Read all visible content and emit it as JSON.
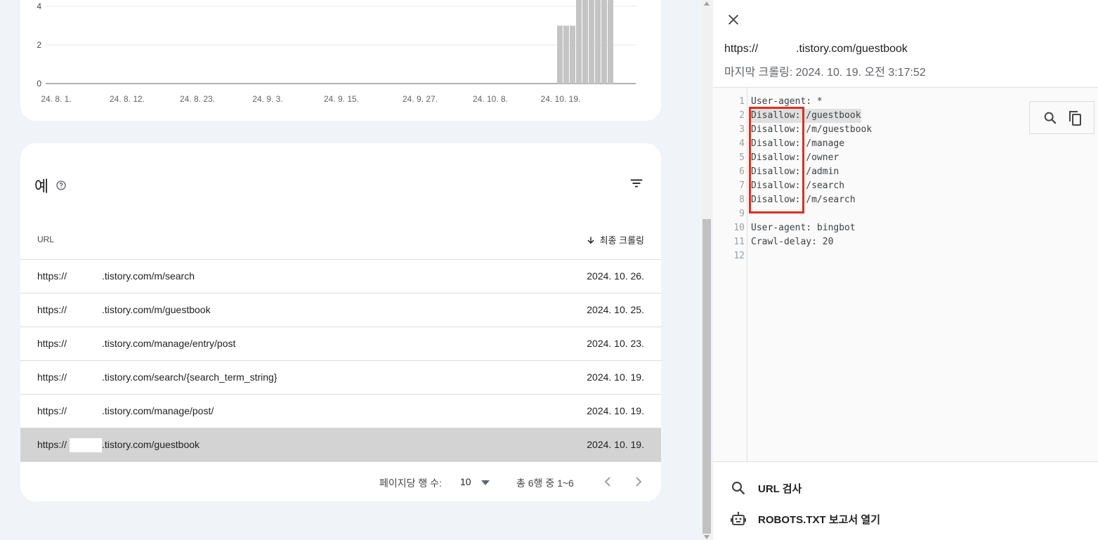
{
  "chart": {
    "chart_data": {
      "type": "bar",
      "y_ticks": [
        "0",
        "2",
        "4"
      ],
      "x_ticks": [
        "24. 8. 1.",
        "24. 8. 12.",
        "24. 8. 23.",
        "24. 9. 3.",
        "24. 9. 15.",
        "24. 9. 27.",
        "24. 10. 8.",
        "24. 10. 19."
      ],
      "ylim": [
        0,
        4
      ],
      "values_note": "",
      "bars": [
        {
          "value": 3
        },
        {
          "value": 3
        },
        {
          "value": 3
        },
        {
          "value": 6
        },
        {
          "value": 6
        },
        {
          "value": 6
        },
        {
          "value": 6
        },
        {
          "value": 6
        },
        {
          "value": 6
        }
      ],
      "bar_color": "#c4c4c4",
      "grid": true
    }
  },
  "table": {
    "title": "예",
    "help_icon": "help-icon",
    "filter_icon": "filter-icon",
    "col_url": "URL",
    "col_date": "최종 크롤링",
    "rows": [
      {
        "scheme": "https://",
        "path": ".tistory.com/m/search",
        "date": "2024. 10. 26."
      },
      {
        "scheme": "https://",
        "path": ".tistory.com/m/guestbook",
        "date": "2024. 10. 25."
      },
      {
        "scheme": "https://",
        "path": ".tistory.com/manage/entry/post",
        "date": "2024. 10. 23."
      },
      {
        "scheme": "https://",
        "path": ".tistory.com/search/{search_term_string}",
        "date": "2024. 10. 19."
      },
      {
        "scheme": "https://",
        "path": ".tistory.com/manage/post/",
        "date": "2024. 10. 19."
      },
      {
        "scheme": "https://",
        "path": ".tistory.com/guestbook",
        "date": "2024. 10. 19."
      }
    ],
    "pagination": {
      "rows_per_page_label": "페이지당 행 수:",
      "rows_per_page": "10",
      "range": "총 6행 중 1~6"
    }
  },
  "panel": {
    "url_scheme": "https://",
    "url_path": ".tistory.com/guestbook",
    "last_crawl": "마지막 크롤링: 2024. 10. 19. 오전 3:17:52",
    "code": [
      {
        "n": "1",
        "text": "User-agent: *"
      },
      {
        "n": "2",
        "text": "Disallow: /guestbook"
      },
      {
        "n": "3",
        "text": "Disallow: /m/guestbook"
      },
      {
        "n": "4",
        "text": "Disallow: /manage"
      },
      {
        "n": "5",
        "text": "Disallow: /owner"
      },
      {
        "n": "6",
        "text": "Disallow: /admin"
      },
      {
        "n": "7",
        "text": "Disallow: /search"
      },
      {
        "n": "8",
        "text": "Disallow: /m/search"
      },
      {
        "n": "9",
        "text": ""
      },
      {
        "n": "10",
        "text": "User-agent: bingbot"
      },
      {
        "n": "11",
        "text": "Crawl-delay: 20"
      },
      {
        "n": "12",
        "text": ""
      }
    ],
    "actions": {
      "url_inspect": "URL 검사",
      "open_robots": "ROBOTS.TXT 보고서 열기"
    },
    "annotation_color": "#d93025"
  }
}
